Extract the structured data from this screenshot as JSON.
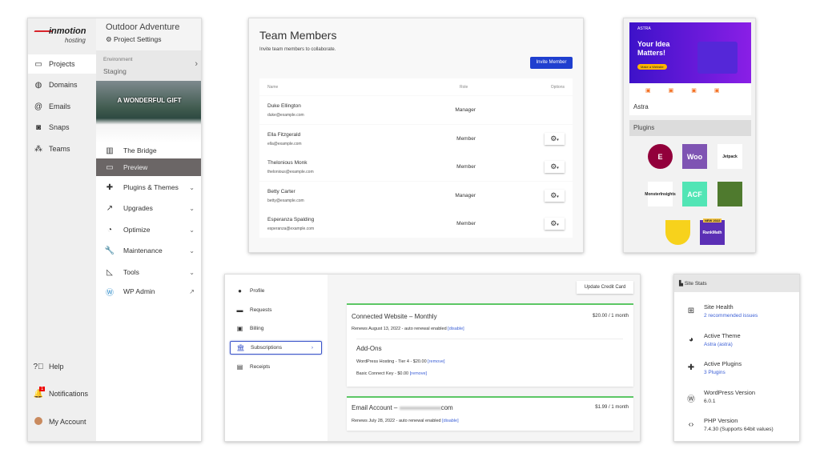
{
  "left_panel": {
    "logo": {
      "brand": "inmotion",
      "sub": "hosting"
    },
    "nav": [
      {
        "label": "Projects",
        "icon": "window-icon"
      },
      {
        "label": "Domains",
        "icon": "globe-icon"
      },
      {
        "label": "Emails",
        "icon": "at-icon"
      },
      {
        "label": "Snaps",
        "icon": "camera-icon"
      },
      {
        "label": "Teams",
        "icon": "people-icon"
      }
    ],
    "bottom_nav": [
      {
        "label": "Help",
        "icon": "help-icon"
      },
      {
        "label": "Notifications",
        "icon": "bell-icon",
        "badge": "1"
      },
      {
        "label": "My Account",
        "icon": "avatar"
      }
    ],
    "project_title": "Outdoor Adventure",
    "project_settings": "Project Settings",
    "environment_label": "Environment",
    "environment_value": "Staging",
    "preview_headline": "A WONDERFUL GIFT",
    "project_items": [
      {
        "label": "The Bridge",
        "icon": "chart-icon"
      },
      {
        "label": "Preview",
        "icon": "monitor-icon"
      },
      {
        "label": "Plugins & Themes",
        "icon": "puzzle-icon"
      },
      {
        "label": "Upgrades",
        "icon": "trend-icon"
      },
      {
        "label": "Optimize",
        "icon": "gauge-icon"
      },
      {
        "label": "Maintenance",
        "icon": "wrench-icon"
      },
      {
        "label": "Tools",
        "icon": "ruler-icon"
      },
      {
        "label": "WP Admin",
        "icon": "wordpress-icon"
      }
    ]
  },
  "team": {
    "title": "Team Members",
    "subtitle": "Invite team members to collaborate.",
    "invite_button": "Invite Member",
    "columns": [
      "Name",
      "Role",
      "Options"
    ],
    "rows": [
      {
        "name": "Duke Ellington",
        "email": "duke@example.com",
        "role": "Manager",
        "options": false
      },
      {
        "name": "Ella Fitzgerald",
        "email": "ella@example.com",
        "role": "Member",
        "options": true
      },
      {
        "name": "Thelonious Monk",
        "email": "thelonious@example.com",
        "role": "Member",
        "options": true
      },
      {
        "name": "Betty Carter",
        "email": "betty@example.com",
        "role": "Manager",
        "options": true
      },
      {
        "name": "Esperanza Spalding",
        "email": "esperanza@example.com",
        "role": "Member",
        "options": true
      }
    ]
  },
  "theme": {
    "hero_brand": "ASTRA",
    "hero_title": "Your Idea Matters!",
    "hero_button": "Make a Website",
    "theme_name": "Astra",
    "plugins_header": "Plugins",
    "plugins": [
      {
        "name": "Elementor",
        "label": "E",
        "color": "#92003b"
      },
      {
        "name": "WooCommerce",
        "label": "Woo",
        "color": "#7f54b3"
      },
      {
        "name": "Jetpack",
        "label": "Jetpack",
        "color": "#ffffff"
      },
      {
        "name": "MonsterInsights",
        "label": "MonsterInsights",
        "color": "#ffffff"
      },
      {
        "name": "ACF",
        "label": "ACF",
        "color": "#52e5b5"
      },
      {
        "name": "Flowers",
        "label": "",
        "color": "#4f7a2e"
      },
      {
        "name": "Shield",
        "label": "",
        "color": "#f7d21c"
      },
      {
        "name": "RankMath",
        "label": "RankMath",
        "color": "#5b2fb5",
        "badge": "NEW 2022"
      }
    ]
  },
  "billing": {
    "nav": [
      {
        "label": "Profile",
        "icon": "info-icon"
      },
      {
        "label": "Requests",
        "icon": "ticket-icon"
      },
      {
        "label": "Billing",
        "icon": "money-icon"
      },
      {
        "label": "Subscriptions",
        "icon": "bank-icon"
      },
      {
        "label": "Receipts",
        "icon": "receipt-icon"
      }
    ],
    "update_button": "Update Credit Card",
    "sub1": {
      "title": "Connected Website – Monthly",
      "price": "$20.00 / 1 month",
      "renew": "Renews August 13, 2022 - auto renewal enabled",
      "disable": "[disable]",
      "addons_title": "Add-Ons",
      "addons": [
        {
          "text": "WordPress Hosting - Tier 4 - $20.00",
          "action": "[remove]"
        },
        {
          "text": "Basic Connect Key - $0.00",
          "action": "[remove]"
        }
      ]
    },
    "sub2": {
      "title_prefix": "Email Account – ",
      "title_suffix": "com",
      "price": "$1.99 / 1 month",
      "renew": "Renews July 28, 2022 - auto renewal enabled",
      "disable": "[disable]"
    }
  },
  "stats": {
    "title": "Site Stats",
    "items": [
      {
        "label": "Site Health",
        "value": "2 recommended issues",
        "link": true,
        "icon": "plus-box-icon"
      },
      {
        "label": "Active Theme",
        "value": "Astra (astra)",
        "link": true,
        "icon": "palette-icon"
      },
      {
        "label": "Active Plugins",
        "value": "3 Plugins",
        "link": true,
        "icon": "puzzle-icon"
      },
      {
        "label": "WordPress Version",
        "value": "6.0.1",
        "link": false,
        "icon": "wordpress-icon"
      },
      {
        "label": "PHP Version",
        "value": "7.4.30 (Supports 64bit values)",
        "link": false,
        "icon": "code-icon"
      }
    ]
  }
}
